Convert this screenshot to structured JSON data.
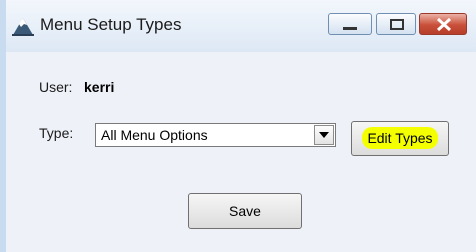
{
  "window": {
    "title": "Menu Setup Types",
    "controls": {
      "minimize": "minimize",
      "maximize": "maximize",
      "close": "close"
    }
  },
  "form": {
    "user_label": "User:",
    "user_value": "kerri",
    "type_label": "Type:",
    "type_value": "All Menu Options",
    "edit_types_label": "Edit Types",
    "save_label": "Save"
  },
  "colors": {
    "title_bar": "#dde8f5",
    "highlight": "#f4ff00",
    "close_button": "#c9503a",
    "panel_bg": "#eef2f8"
  },
  "icons": {
    "app": "mountain-icon",
    "dropdown": "chevron-down-icon"
  }
}
